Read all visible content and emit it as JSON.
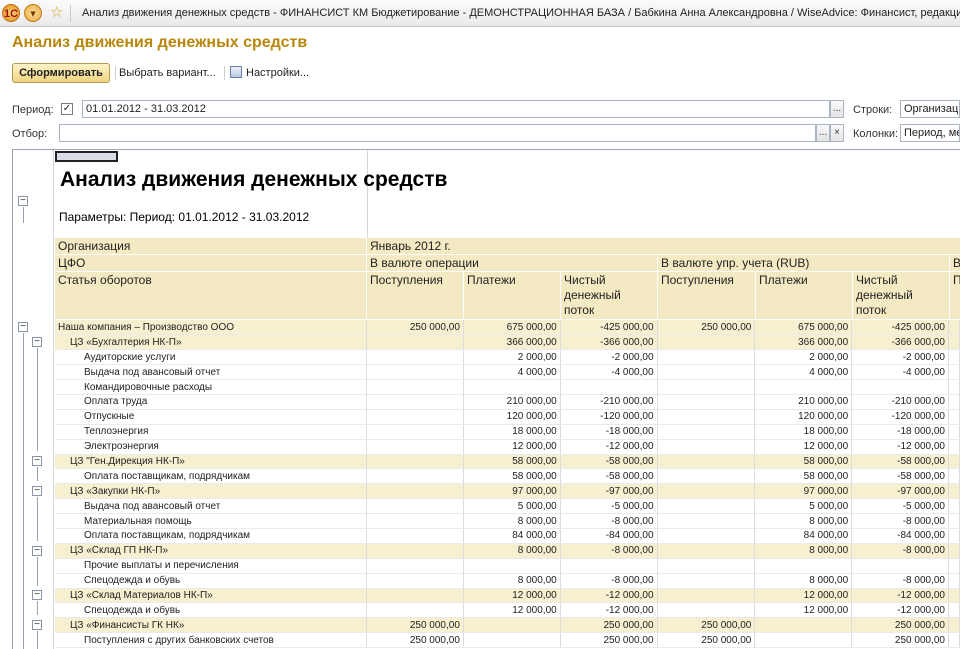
{
  "window": {
    "title": "Анализ движения денежных средств - ФИНАНСИСТ КМ Бюджетирование - ДЕМОНСТРАЦИОННАЯ БАЗА / Бабкина Анна Александровна / WiseAdvice: Финансист, редакция"
  },
  "report_title": "Анализ движения денежных средств",
  "toolbar": {
    "generate": "Сформировать",
    "choose_variant": "Выбрать вариант...",
    "settings": "Настройки..."
  },
  "params": {
    "period_label": "Период:",
    "period_checked": "✓",
    "period_value": "01.01.2012 - 31.03.2012",
    "filter_label": "Отбор:",
    "filter_value": "",
    "rows_label": "Строки:",
    "rows_value": "Организация",
    "cols_label": "Колонки:",
    "cols_value": "Период, ме",
    "dots": "...",
    "clear": "×"
  },
  "report": {
    "heading": "Анализ движения денежных средств",
    "parameters_line": "Параметры:     Период: 01.01.2012 - 31.03.2012",
    "headers": {
      "org": "Организация",
      "cfo": "ЦФО",
      "article": "Статья оборотов",
      "month": "Январь 2012 г.",
      "currency_op": "В валюте операции",
      "currency_mgmt": "В валюте упр. учета (RUB)",
      "next_group": "В",
      "receipts": "Поступления",
      "payments": "Платежи",
      "net_flow": "Чистый денежный поток",
      "next_col": "П"
    },
    "rows": [
      {
        "level": 0,
        "name": "Наша компания – Производство ООО",
        "r1": "250 000,00",
        "p1": "675 000,00",
        "n1": "-425 000,00",
        "r2": "250 000,00",
        "p2": "675 000,00",
        "n2": "-425 000,00"
      },
      {
        "level": 1,
        "name": "ЦЗ «Бухгалтерия НК-П»",
        "r1": "",
        "p1": "366 000,00",
        "n1": "-366 000,00",
        "r2": "",
        "p2": "366 000,00",
        "n2": "-366 000,00"
      },
      {
        "level": 2,
        "name": "Аудиторские услуги",
        "r1": "",
        "p1": "2 000,00",
        "n1": "-2 000,00",
        "r2": "",
        "p2": "2 000,00",
        "n2": "-2 000,00"
      },
      {
        "level": 2,
        "name": "Выдача под авансовый отчет",
        "r1": "",
        "p1": "4 000,00",
        "n1": "-4 000,00",
        "r2": "",
        "p2": "4 000,00",
        "n2": "-4 000,00"
      },
      {
        "level": 2,
        "name": "Командировочные расходы",
        "r1": "",
        "p1": "",
        "n1": "",
        "r2": "",
        "p2": "",
        "n2": ""
      },
      {
        "level": 2,
        "name": "Оплата труда",
        "r1": "",
        "p1": "210 000,00",
        "n1": "-210 000,00",
        "r2": "",
        "p2": "210 000,00",
        "n2": "-210 000,00"
      },
      {
        "level": 2,
        "name": "Отпускные",
        "r1": "",
        "p1": "120 000,00",
        "n1": "-120 000,00",
        "r2": "",
        "p2": "120 000,00",
        "n2": "-120 000,00"
      },
      {
        "level": 2,
        "name": "Теплоэнергия",
        "r1": "",
        "p1": "18 000,00",
        "n1": "-18 000,00",
        "r2": "",
        "p2": "18 000,00",
        "n2": "-18 000,00"
      },
      {
        "level": 2,
        "name": "Электроэнергия",
        "r1": "",
        "p1": "12 000,00",
        "n1": "-12 000,00",
        "r2": "",
        "p2": "12 000,00",
        "n2": "-12 000,00"
      },
      {
        "level": 1,
        "name": "ЦЗ \"Ген.Дирекция НК-П»",
        "r1": "",
        "p1": "58 000,00",
        "n1": "-58 000,00",
        "r2": "",
        "p2": "58 000,00",
        "n2": "-58 000,00"
      },
      {
        "level": 2,
        "name": "Оплата поставщикам, подрядчикам",
        "r1": "",
        "p1": "58 000,00",
        "n1": "-58 000,00",
        "r2": "",
        "p2": "58 000,00",
        "n2": "-58 000,00"
      },
      {
        "level": 1,
        "name": "ЦЗ «Закупки НК-П»",
        "r1": "",
        "p1": "97 000,00",
        "n1": "-97 000,00",
        "r2": "",
        "p2": "97 000,00",
        "n2": "-97 000,00"
      },
      {
        "level": 2,
        "name": "Выдача под авансовый отчет",
        "r1": "",
        "p1": "5 000,00",
        "n1": "-5 000,00",
        "r2": "",
        "p2": "5 000,00",
        "n2": "-5 000,00"
      },
      {
        "level": 2,
        "name": "Материальная помощь",
        "r1": "",
        "p1": "8 000,00",
        "n1": "-8 000,00",
        "r2": "",
        "p2": "8 000,00",
        "n2": "-8 000,00"
      },
      {
        "level": 2,
        "name": "Оплата поставщикам, подрядчикам",
        "r1": "",
        "p1": "84 000,00",
        "n1": "-84 000,00",
        "r2": "",
        "p2": "84 000,00",
        "n2": "-84 000,00"
      },
      {
        "level": 1,
        "name": "ЦЗ «Склад ГП НК-П»",
        "r1": "",
        "p1": "8 000,00",
        "n1": "-8 000,00",
        "r2": "",
        "p2": "8 000,00",
        "n2": "-8 000,00"
      },
      {
        "level": 2,
        "name": "Прочие выплаты и перечисления",
        "r1": "",
        "p1": "",
        "n1": "",
        "r2": "",
        "p2": "",
        "n2": ""
      },
      {
        "level": 2,
        "name": "Спецодежда и обувь",
        "r1": "",
        "p1": "8 000,00",
        "n1": "-8 000,00",
        "r2": "",
        "p2": "8 000,00",
        "n2": "-8 000,00"
      },
      {
        "level": 1,
        "name": "ЦЗ «Склад Материалов НК-П»",
        "r1": "",
        "p1": "12 000,00",
        "n1": "-12 000,00",
        "r2": "",
        "p2": "12 000,00",
        "n2": "-12 000,00"
      },
      {
        "level": 2,
        "name": "Спецодежда и обувь",
        "r1": "",
        "p1": "12 000,00",
        "n1": "-12 000,00",
        "r2": "",
        "p2": "12 000,00",
        "n2": "-12 000,00"
      },
      {
        "level": 1,
        "name": "ЦЗ «Финансисты ГК НК»",
        "r1": "250 000,00",
        "p1": "",
        "n1": "250 000,00",
        "r2": "250 000,00",
        "p2": "",
        "n2": "250 000,00"
      },
      {
        "level": 2,
        "name": "Поступления с других банковских счетов",
        "r1": "250 000,00",
        "p1": "",
        "n1": "250 000,00",
        "r2": "250 000,00",
        "p2": "",
        "n2": "250 000,00"
      }
    ]
  }
}
